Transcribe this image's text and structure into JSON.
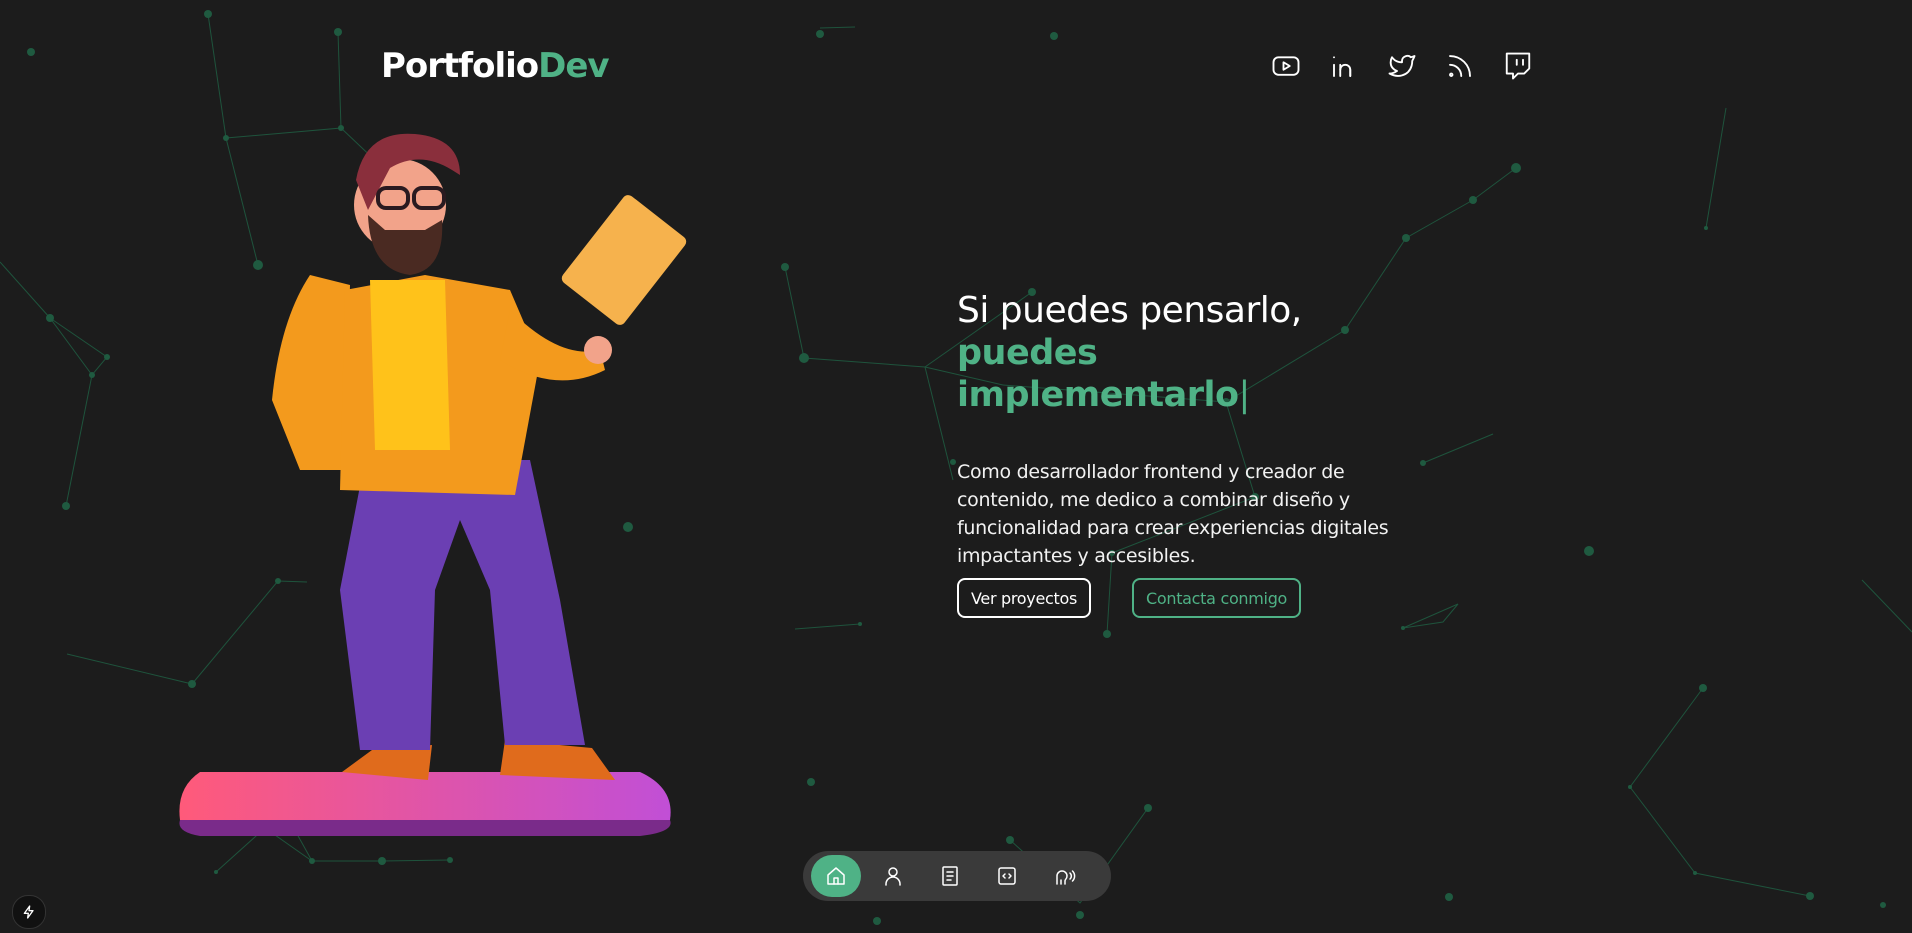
{
  "header": {
    "logo_main": "Portfolio",
    "logo_accent": "Dev",
    "socials": [
      {
        "name": "youtube-icon"
      },
      {
        "name": "linkedin-icon"
      },
      {
        "name": "twitter-icon"
      },
      {
        "name": "rss-icon"
      },
      {
        "name": "twitch-icon"
      }
    ]
  },
  "hero": {
    "title_line1": "Si puedes pensarlo,",
    "title_line2": "puedes implementarlo",
    "cursor": "|",
    "description": "Como desarrollador frontend y creador de contenido, me dedico a combinar diseño y funcionalidad para crear experiencias digitales impactantes y accesibles.",
    "primary_button": "Ver proyectos",
    "secondary_button": "Contacta conmigo"
  },
  "dock": {
    "items": [
      {
        "icon": "home-icon",
        "active": true
      },
      {
        "icon": "user-icon",
        "active": false
      },
      {
        "icon": "book-icon",
        "active": false
      },
      {
        "icon": "code-icon",
        "active": false
      },
      {
        "icon": "voice-icon",
        "active": false
      }
    ]
  },
  "colors": {
    "background": "#1c1c1c",
    "accent": "#4fb286",
    "dock": "#3a3a3a"
  }
}
